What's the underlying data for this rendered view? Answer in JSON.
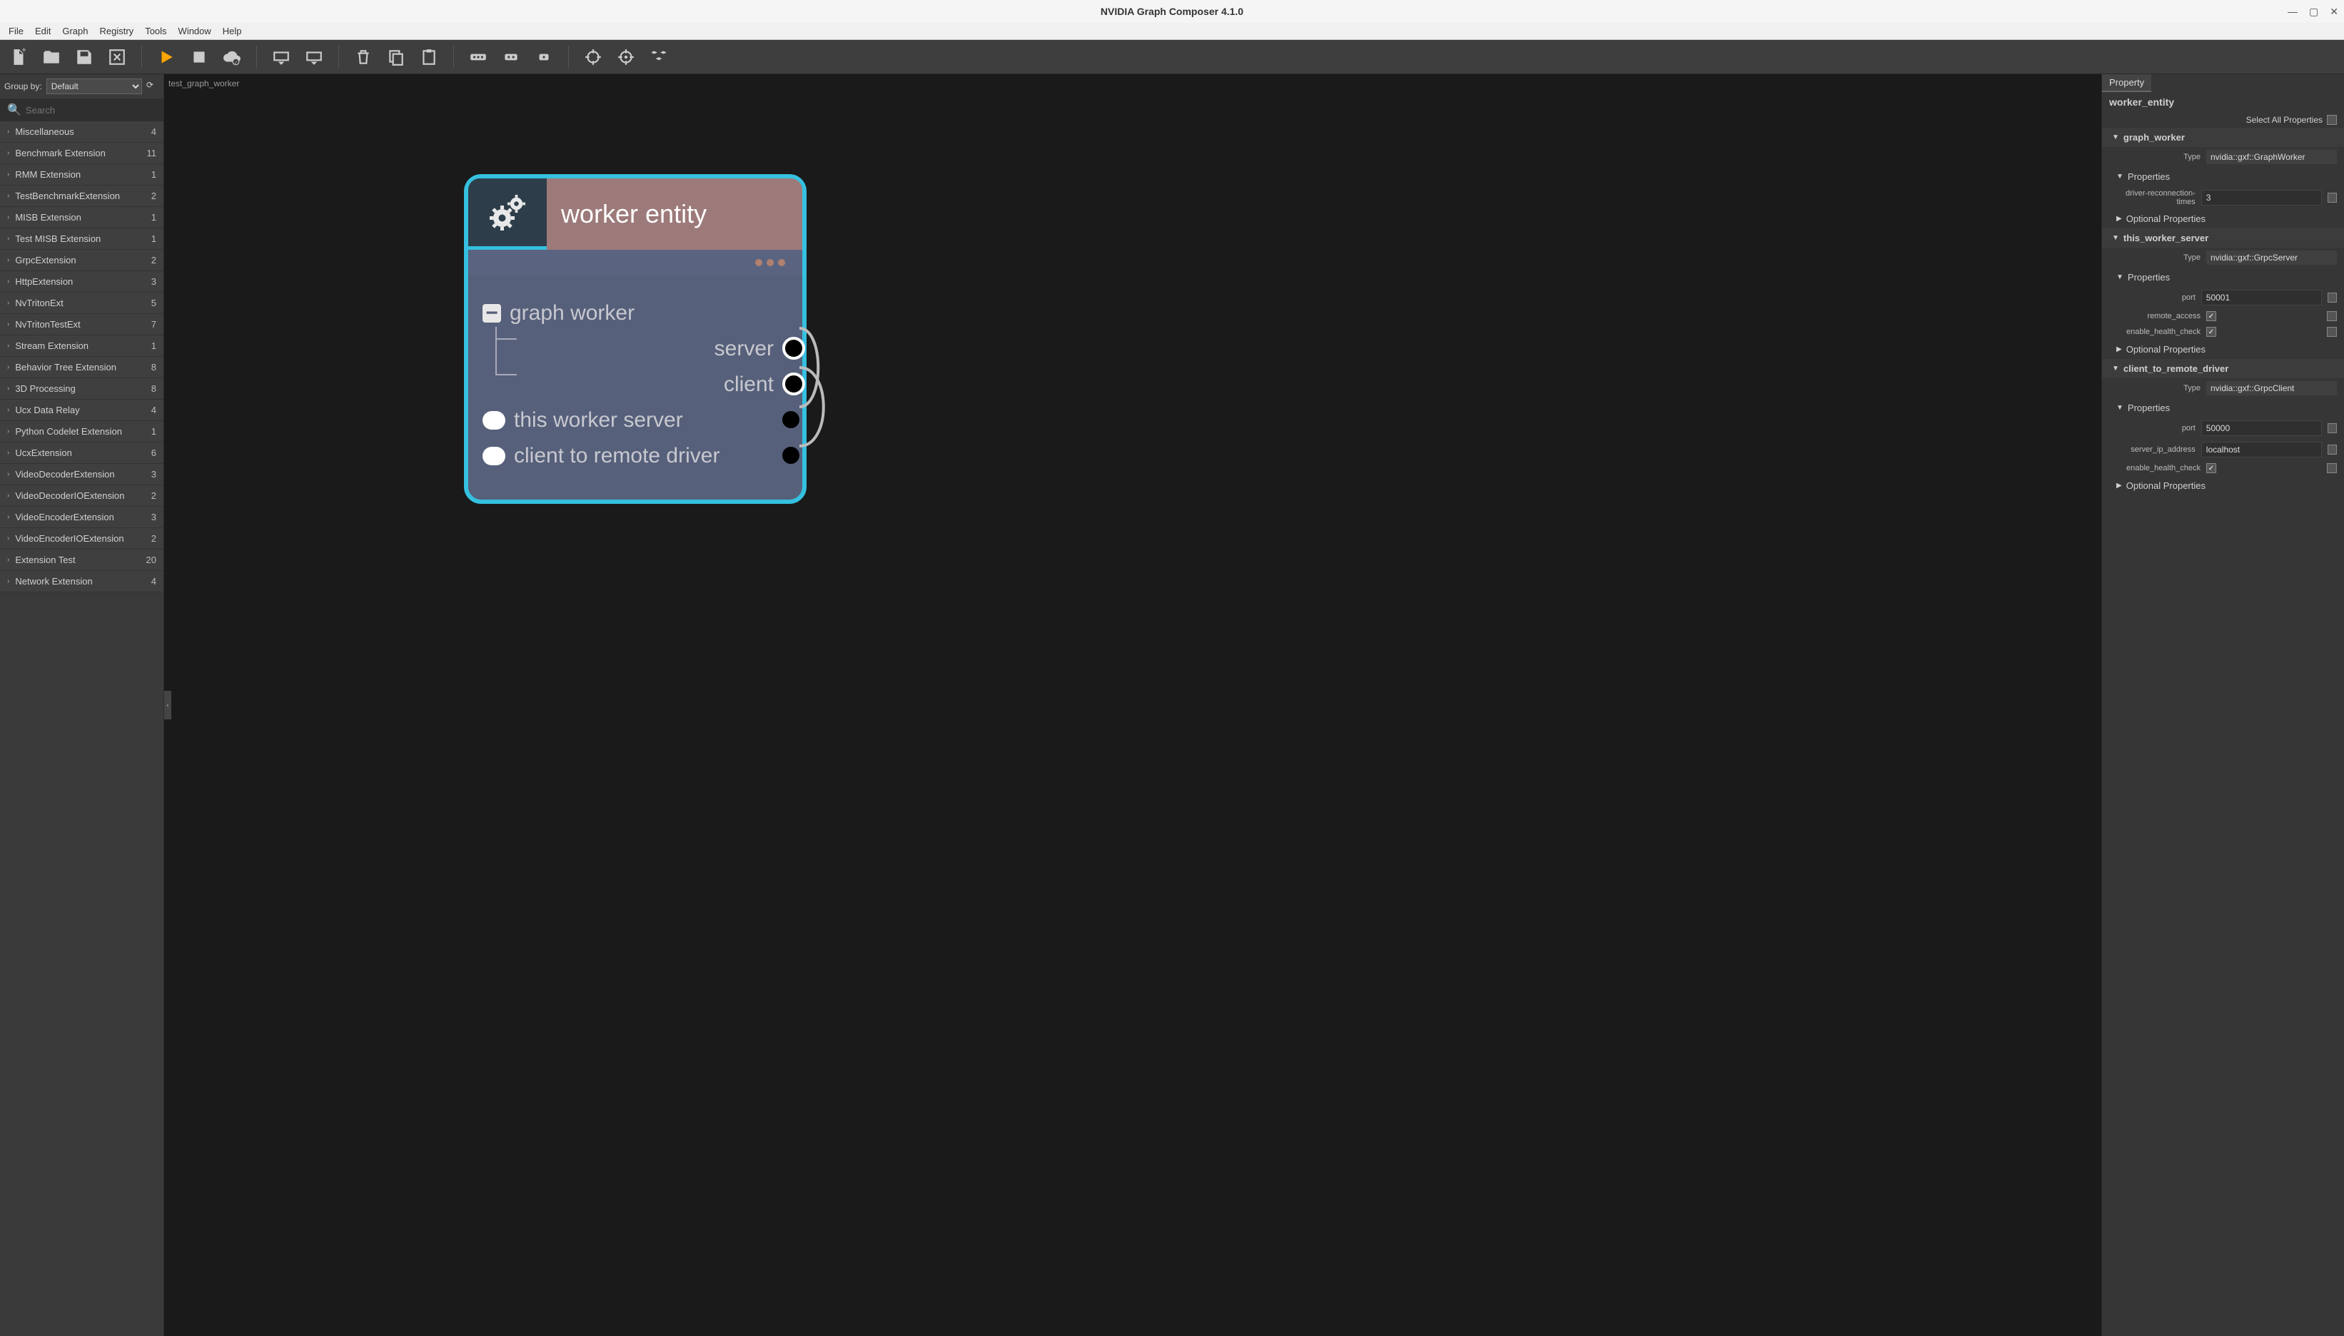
{
  "window": {
    "title": "NVIDIA Graph Composer 4.1.0"
  },
  "menu": [
    "File",
    "Edit",
    "Graph",
    "Registry",
    "Tools",
    "Window",
    "Help"
  ],
  "groupby": {
    "label": "Group by:",
    "value": "Default"
  },
  "search": {
    "placeholder": "Search"
  },
  "categories": [
    {
      "label": "Miscellaneous",
      "count": 4
    },
    {
      "label": "Benchmark Extension",
      "count": 11
    },
    {
      "label": "RMM Extension",
      "count": 1
    },
    {
      "label": "TestBenchmarkExtension",
      "count": 2
    },
    {
      "label": "MISB Extension",
      "count": 1
    },
    {
      "label": "Test MISB Extension",
      "count": 1
    },
    {
      "label": "GrpcExtension",
      "count": 2
    },
    {
      "label": "HttpExtension",
      "count": 3
    },
    {
      "label": "NvTritonExt",
      "count": 5
    },
    {
      "label": "NvTritonTestExt",
      "count": 7
    },
    {
      "label": "Stream Extension",
      "count": 1
    },
    {
      "label": "Behavior Tree Extension",
      "count": 8
    },
    {
      "label": "3D Processing",
      "count": 8
    },
    {
      "label": "Ucx Data Relay",
      "count": 4
    },
    {
      "label": "Python Codelet Extension",
      "count": 1
    },
    {
      "label": "UcxExtension",
      "count": 6
    },
    {
      "label": "VideoDecoderExtension",
      "count": 3
    },
    {
      "label": "VideoDecoderIOExtension",
      "count": 2
    },
    {
      "label": "VideoEncoderExtension",
      "count": 3
    },
    {
      "label": "VideoEncoderIOExtension",
      "count": 2
    },
    {
      "label": "Extension Test",
      "count": 20
    },
    {
      "label": "Network Extension",
      "count": 4
    }
  ],
  "canvas": {
    "tab": "test_graph_worker",
    "node": {
      "title": "worker entity",
      "gw_label": "graph worker",
      "server_label": "server",
      "client_label": "client",
      "tws_label": "this worker server",
      "ctrd_label": "client to remote driver"
    }
  },
  "props": {
    "tab": "Property",
    "entity": "worker_entity",
    "selall": "Select All Properties",
    "type_lbl": "Type",
    "props_lbl": "Properties",
    "opt_lbl": "Optional Properties",
    "gw": {
      "name": "graph_worker",
      "type": "nvidia::gxf::GraphWorker",
      "drt_lbl": "driver-reconnection-times",
      "drt_val": "3"
    },
    "tws": {
      "name": "this_worker_server",
      "type": "nvidia::gxf::GrpcServer",
      "port_lbl": "port",
      "port_val": "50001",
      "ra_lbl": "remote_access",
      "hc_lbl": "enable_health_check"
    },
    "ctrd": {
      "name": "client_to_remote_driver",
      "type": "nvidia::gxf::GrpcClient",
      "port_lbl": "port",
      "port_val": "50000",
      "sip_lbl": "server_ip_address",
      "sip_val": "localhost",
      "hc_lbl": "enable_health_check"
    }
  }
}
